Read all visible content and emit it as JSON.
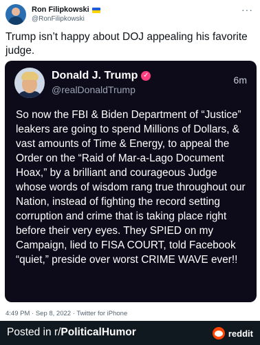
{
  "tweet": {
    "author_name": "Ron Filipkowski",
    "author_handle": "@RonFilipkowski",
    "more_label": "···",
    "text": "Trump isn’t happy about DOJ appealing his favorite judge."
  },
  "quoted": {
    "name": "Donald J. Trump",
    "verified_label": "✓",
    "handle": "@realDonaldTrump",
    "time": "6m",
    "body": "So now the FBI & Biden Department of “Justice” leakers are going to spend Millions of Dollars, & vast amounts of Time & Energy, to appeal the Order on the “Raid of Mar-a-Lago Document Hoax,” by a brilliant and courageous Judge whose words of wisdom rang true throughout our Nation, instead of fighting the record setting corruption and crime that is taking place right before their very eyes. They SPIED on my Campaign, lied to FISA COURT, told Facebook “quiet,” preside over worst CRIME WAVE ever!!"
  },
  "meta": {
    "timestamp": "4:49 PM · Sep 8, 2022 · Twitter for iPhone"
  },
  "footer": {
    "posted_in": "Posted in r/",
    "subreddit": "PoliticalHumor",
    "brand": "reddit"
  },
  "colors": {
    "card_bg": "#0d0b1a",
    "verified_badge": "#ff3f7f",
    "footer_bg": "#101820",
    "reddit_orange": "#ff4500"
  }
}
